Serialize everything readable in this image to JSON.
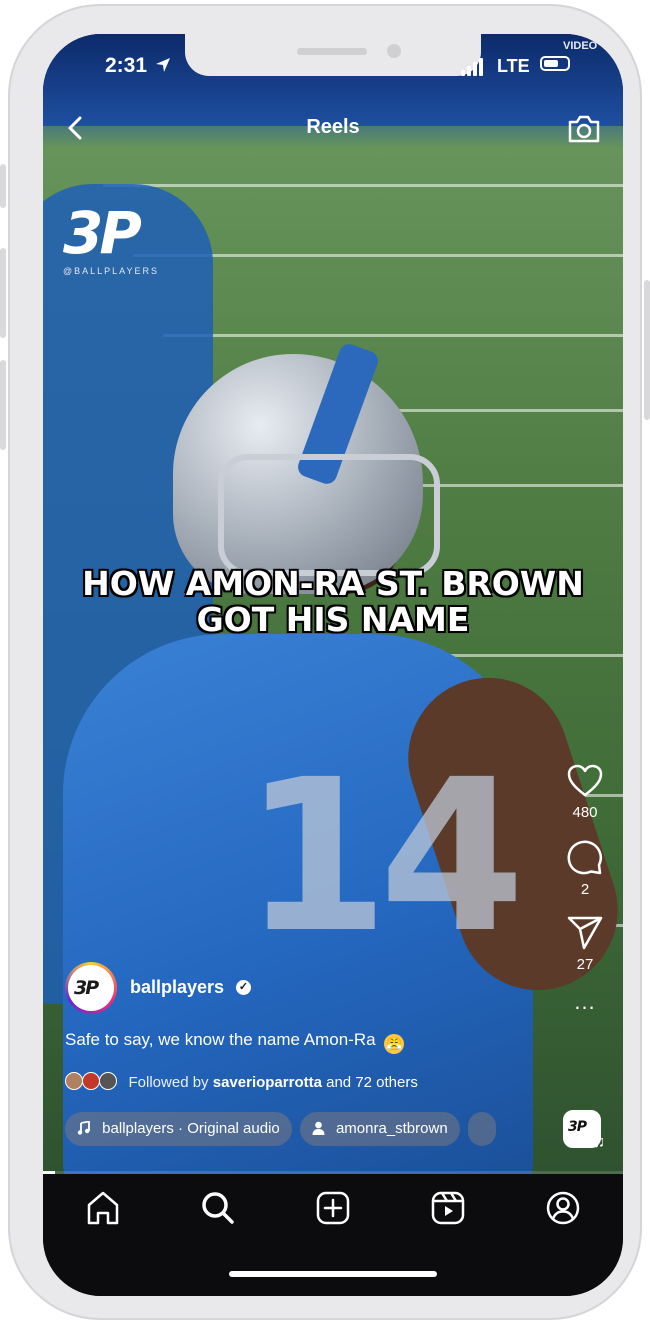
{
  "status_bar": {
    "time": "2:31",
    "network": "LTE",
    "video_label": "VIDEO"
  },
  "header": {
    "title": "Reels",
    "back_icon": "chevron-left-icon",
    "camera_icon": "camera-icon"
  },
  "video": {
    "watermark_logo": "3P",
    "watermark_handle": "@BALLPLAYERS",
    "headline": "HOW AMON-RA ST. BROWN GOT HIS NAME",
    "jersey_number": "14",
    "progress": 0.02
  },
  "actions": {
    "likes": "480",
    "comments": "2",
    "shares": "27",
    "more": "..."
  },
  "post": {
    "avatar_logo": "3P",
    "username": "ballplayers",
    "caption": "Safe to say, we know the name Amon-Ra",
    "caption_emoji": "😤",
    "followed_prefix": "Followed by",
    "followed_user": "saverioparrotta",
    "followed_suffix": "and 72 others"
  },
  "chips": [
    {
      "icon": "music-note-icon",
      "label": "ballplayers · Original audio"
    },
    {
      "icon": "person-icon",
      "label": "amonra_stbrown"
    }
  ],
  "tabs": [
    "home-icon",
    "search-icon",
    "create-icon",
    "reels-icon",
    "profile-icon"
  ],
  "colors": {
    "jersey_blue": "#2467bf",
    "field_green": "#4f7d43",
    "bar_bg": "#0c0c0e"
  }
}
